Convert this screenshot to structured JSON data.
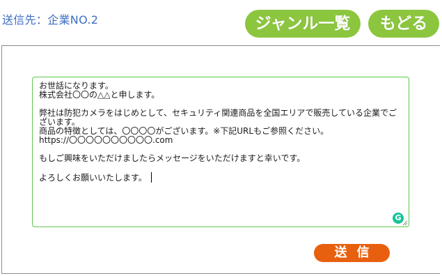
{
  "header": {
    "recipient_text": "送信先：企業NO.2",
    "genre_list_label": "ジャンル一覧",
    "back_label": "もどる"
  },
  "message": {
    "lines": [
      "お世話になります。",
      "株式会社〇〇の△△と申します。",
      "",
      "弊社は防犯カメラをはじめとして、セキュリティ関連商品を全国エリアで販売している企業でご",
      "ざいます。",
      "商品の特徴としては、〇〇〇〇がございます。※下記URLもご参照ください。",
      "https://〇〇〇〇〇〇〇〇〇〇.com",
      "",
      "もしご興味をいただけましたらメッセージをいただけますと幸いです。",
      "",
      "よろしくお願いいたします。"
    ],
    "assistant_icon": "grammarly-icon",
    "assistant_glyph": "G"
  },
  "actions": {
    "send_label": "送信"
  },
  "colors": {
    "recipient_text": "#3d6fc4",
    "nav_button": "#8cc63f",
    "send_button": "#e8600f",
    "textarea_border": "#5cc84a"
  }
}
